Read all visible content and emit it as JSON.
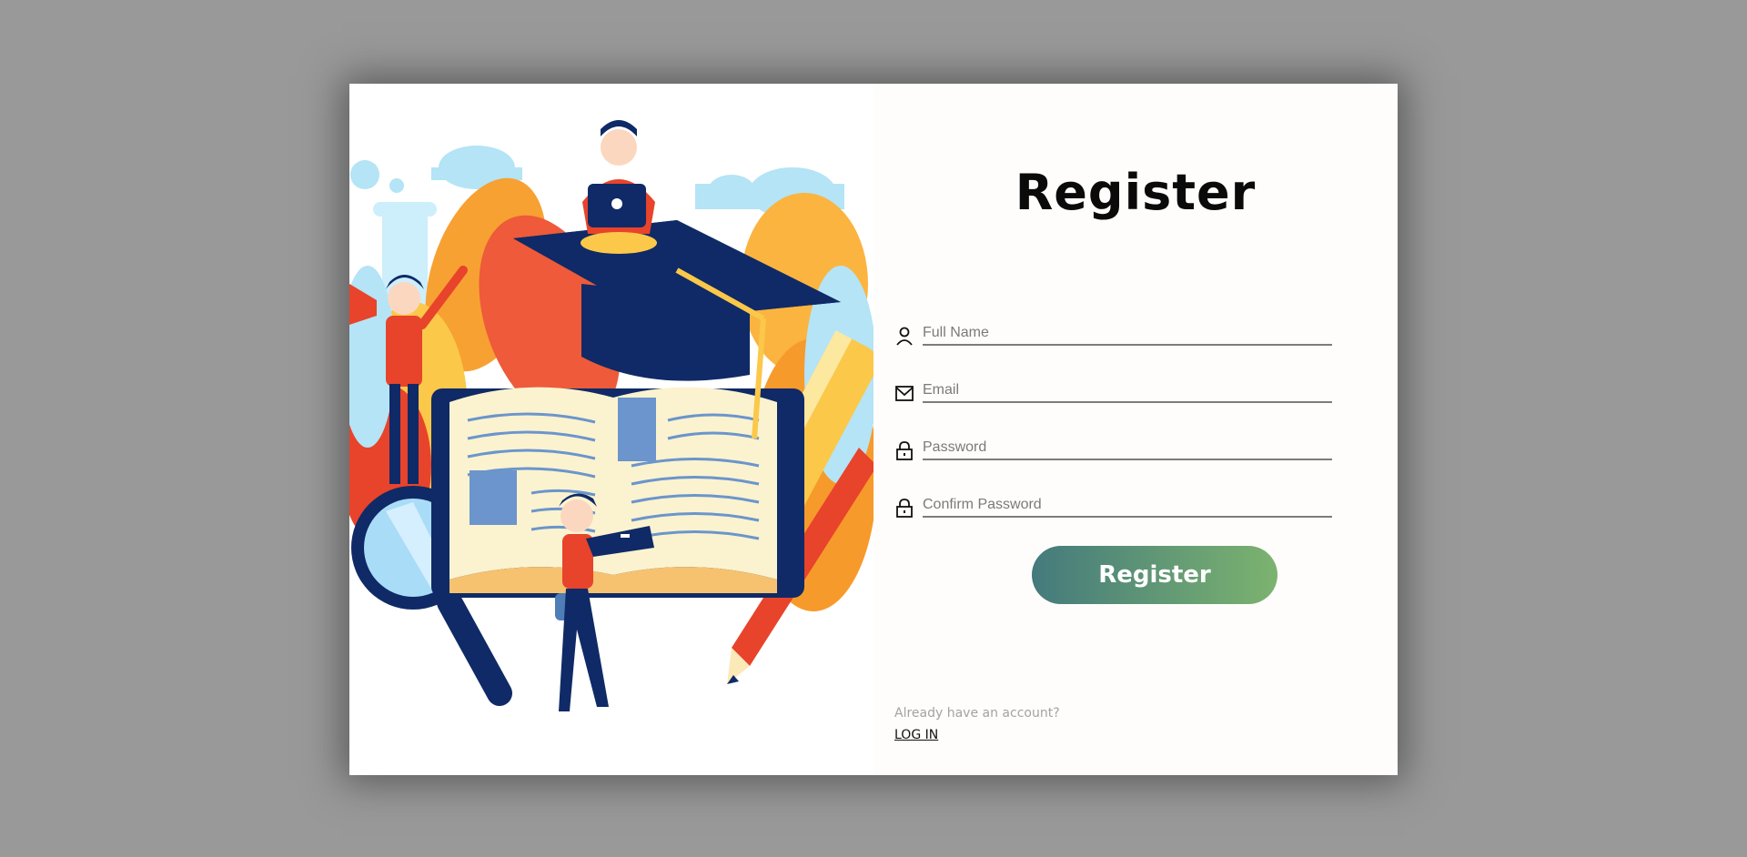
{
  "form": {
    "title": "Register",
    "fields": [
      {
        "icon": "user-icon",
        "placeholder": "Full Name",
        "value": ""
      },
      {
        "icon": "mail-icon",
        "placeholder": "Email",
        "value": ""
      },
      {
        "icon": "lock-icon",
        "placeholder": "Password",
        "value": ""
      },
      {
        "icon": "lock-icon",
        "placeholder": "Confirm Password",
        "value": ""
      }
    ],
    "submit_label": "Register",
    "footer_prompt": "Already have an account?",
    "login_label": "LOG IN"
  },
  "colors": {
    "background": "#999999",
    "card": "#fffdfb",
    "button_start": "#447a7c",
    "button_end": "#7cb36f",
    "navy": "#0f2a66",
    "red": "#e8432b",
    "orange": "#f7a132",
    "yellow": "#fbc84a",
    "sky": "#b4e4f6"
  }
}
